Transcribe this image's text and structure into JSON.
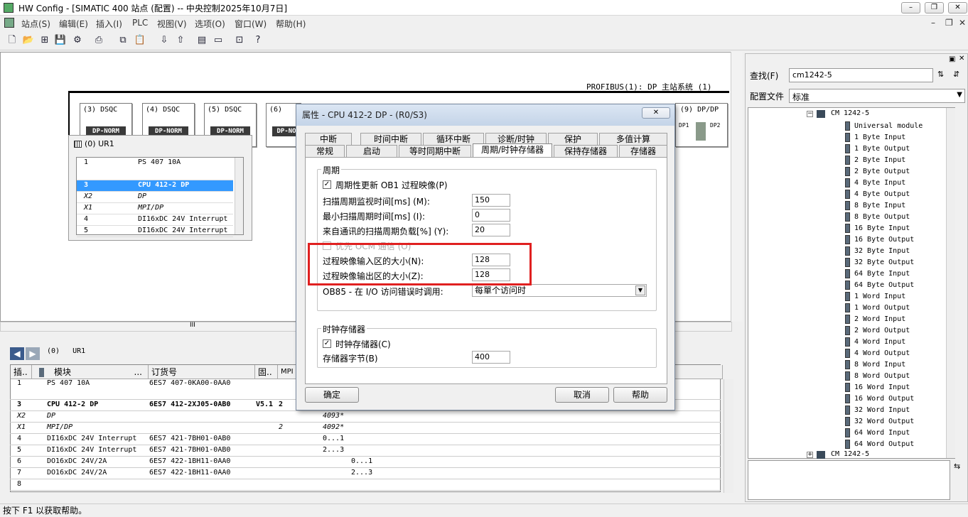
{
  "window": {
    "title": "HW Config - [SIMATIC 400 站点 (配置) -- 中央控制2025年10月7日]"
  },
  "menu": [
    "站点(S)",
    "编辑(E)",
    "插入(I)",
    "PLC",
    "视图(V)",
    "选项(O)",
    "窗口(W)",
    "帮助(H)"
  ],
  "station": {
    "profibus_label": "PROFIBUS(1): DP 主站系统 (1)",
    "slaves": [
      {
        "label": "(3) DSQC",
        "badge": "DP-NORM"
      },
      {
        "label": "(4) DSQC",
        "badge": "DP-NORM"
      },
      {
        "label": "(5) DSQC",
        "badge": "DP-NORM"
      },
      {
        "label": "(6)",
        "badge": "DP-NO"
      },
      {
        "label": "(9) DP/DP",
        "badge": ""
      }
    ],
    "dpdp_left": "DP1",
    "dpdp_right": "DP2",
    "hscroll_mark": "III"
  },
  "ur1": {
    "title": "(0) UR1",
    "rows": [
      {
        "slot": "1",
        "module": "PS 407 10A"
      },
      {
        "slot": "3",
        "module": "CPU 412-2 DP"
      },
      {
        "slot": "X2",
        "module": "DP"
      },
      {
        "slot": "X1",
        "module": "MPI/DP"
      },
      {
        "slot": "4",
        "module": "DI16xDC 24V Interrupt"
      },
      {
        "slot": "5",
        "module": "DI16xDC 24V Interrupt"
      }
    ]
  },
  "bottom": {
    "nav_label": "(0)   UR1",
    "headers": [
      "插..",
      "模块",
      "...",
      "订货号",
      "固..",
      "MPI"
    ],
    "rows": [
      {
        "slot": "1",
        "module": "PS 407 10A",
        "order": "6ES7 407-0KA00-0AA0",
        "fw": "",
        "mpi": "",
        "i": "",
        "q": ""
      },
      {
        "slot": "3",
        "module": "CPU 412-2 DP",
        "order": "6ES7 412-2XJ05-0AB0",
        "fw": "V5.1",
        "mpi": "2",
        "i": "",
        "q": ""
      },
      {
        "slot": "X2",
        "module": "DP",
        "order": "",
        "fw": "",
        "mpi": "",
        "i": "4093*",
        "q": ""
      },
      {
        "slot": "X1",
        "module": "MPI/DP",
        "order": "",
        "fw": "",
        "mpi": "2",
        "i": "4092*",
        "q": ""
      },
      {
        "slot": "4",
        "module": "DI16xDC 24V Interrupt",
        "order": "6ES7 421-7BH01-0AB0",
        "fw": "",
        "mpi": "",
        "i": "0...1",
        "q": ""
      },
      {
        "slot": "5",
        "module": "DI16xDC 24V Interrupt",
        "order": "6ES7 421-7BH01-0AB0",
        "fw": "",
        "mpi": "",
        "i": "2...3",
        "q": ""
      },
      {
        "slot": "6",
        "module": "DO16xDC 24V/2A",
        "order": "6ES7 422-1BH11-0AA0",
        "fw": "",
        "mpi": "",
        "i": "",
        "q": "0...1"
      },
      {
        "slot": "7",
        "module": "DO16xDC 24V/2A",
        "order": "6ES7 422-1BH11-0AA0",
        "fw": "",
        "mpi": "",
        "i": "",
        "q": "2...3"
      },
      {
        "slot": "8",
        "module": "",
        "order": "",
        "fw": "",
        "mpi": "",
        "i": "",
        "q": ""
      }
    ]
  },
  "catalog": {
    "search_label": "查找(F)",
    "search_value": "cm1242-5",
    "profile_label": "配置文件",
    "profile_value": "标准",
    "node_top": "CM 1242-5",
    "node_bottom": "CM 1242-5",
    "items": [
      "Universal module",
      "1 Byte Input",
      "1 Byte Output",
      "2 Byte Input",
      "2 Byte Output",
      "4 Byte Input",
      "4 Byte Output",
      "8 Byte Input",
      "8 Byte Output",
      "16 Byte Input",
      "16 Byte Output",
      "32 Byte Input",
      "32 Byte Output",
      "64 Byte Input",
      "64 Byte Output",
      "1 Word Input",
      "1 Word Output",
      "2 Word Input",
      "2 Word Output",
      "4 Word Input",
      "4 Word Output",
      "8 Word Input",
      "8 Word Output",
      "16 Word Input",
      "16 Word Output",
      "32 Word Input",
      "32 Word Output",
      "64 Word Input",
      "64 Word Output"
    ]
  },
  "dialog": {
    "title": "属性 - CPU 412-2 DP - (R0/S3)",
    "tabs_row1": [
      "中断",
      "时间中断",
      "循环中断",
      "诊断/时钟",
      "保护",
      "多值计算"
    ],
    "tabs_row2": [
      "常规",
      "启动",
      "等时同期中断",
      "周期/时钟存储器",
      "保持存储器",
      "存储器"
    ],
    "group_cycle": "周期",
    "chk_update_ob1": "周期性更新 OB1 过程映像(P)",
    "scan_monitor_label": "扫描周期监视时间[ms] (M):",
    "scan_monitor_value": "150",
    "min_scan_label": "最小扫描周期时间[ms] (I):",
    "min_scan_value": "0",
    "comm_load_label": "来自通讯的扫描周期负载[%] (Y):",
    "comm_load_value": "20",
    "prio_comm_label": "优先 OCM 通信 (O)",
    "pi_input_label": "过程映像输入区的大小(N):",
    "pi_input_value": "128",
    "pi_output_label": "过程映像输出区的大小(Z):",
    "pi_output_value": "128",
    "ob85_label": "OB85 - 在 I/O 访问错误时调用:",
    "ob85_value": "每單个访问时",
    "group_clock": "时钟存储器",
    "chk_clock": "时钟存储器(C)",
    "clock_byte_label": "存储器字节(B)",
    "clock_byte_value": "400",
    "ok": "确定",
    "cancel": "取消",
    "help": "帮助"
  },
  "status": {
    "text": "按下 F1 以获取帮助。"
  }
}
